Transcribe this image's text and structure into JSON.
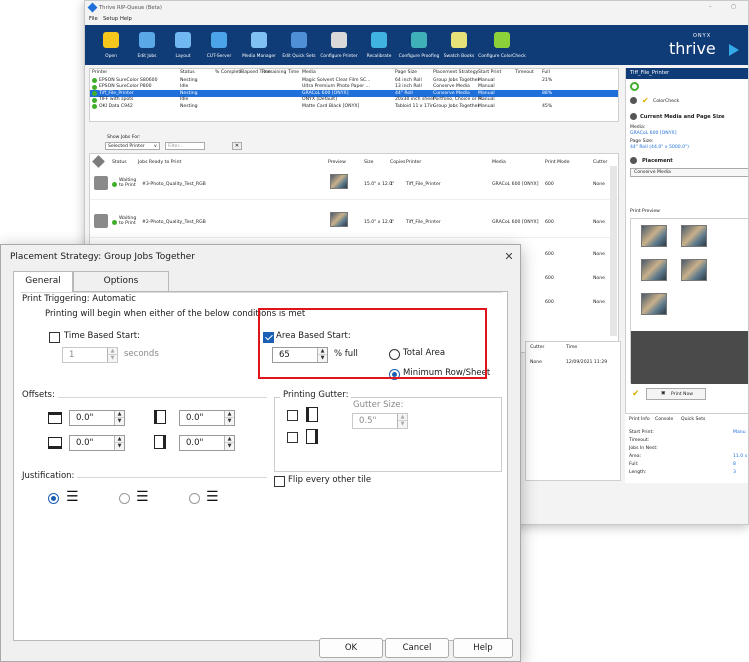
{
  "app": {
    "window_title": "Thrive RIP-Queue (Beta)",
    "menu": [
      "File",
      "Setup",
      "Help"
    ],
    "toolbar": [
      {
        "label": "Open",
        "icon": "folder-icon",
        "color": "#f5c61b"
      },
      {
        "label": "Edit Jobs",
        "icon": "gear-icon",
        "color": "#5aa9e6"
      },
      {
        "label": "Layout",
        "icon": "layout-icon",
        "color": "#6fb8f0"
      },
      {
        "label": "CUT-Server",
        "icon": "scissors-icon",
        "color": "#4da3e8"
      },
      {
        "label": "Media Manager",
        "icon": "media-icon",
        "color": "#7fc1f2"
      },
      {
        "label": "Edit Quick Sets",
        "icon": "quickset-icon",
        "color": "#4f8fd6"
      },
      {
        "label": "Configure Printer",
        "icon": "printer-icon",
        "color": "#d9d9d9"
      },
      {
        "label": "Recalibrate",
        "icon": "recalibrate-icon",
        "color": "#40b3e0"
      },
      {
        "label": "Configure Proofing",
        "icon": "proofing-icon",
        "color": "#3fb0b8"
      },
      {
        "label": "Swatch Books",
        "icon": "swatch-icon",
        "color": "#e6e27a"
      },
      {
        "label": "Configure ColorCheck",
        "icon": "colorcheck-icon",
        "color": "#8bd23a"
      }
    ],
    "brand_small": "ONYX",
    "brand_large": "thrive",
    "printer_columns": [
      "Printer",
      "Status",
      "% Complete",
      "Elapsed Time",
      "Remaining Time",
      "Media",
      "Page Size",
      "Placement Strategy",
      "Start Print",
      "Timeout",
      "Full"
    ],
    "printers": [
      {
        "name": "EPSON SureColor S80600",
        "status": "Nesting",
        "media": "Magic Solvent Clear Film SC...",
        "page": "64 inch Roll",
        "strategy": "Group Jobs Together",
        "start": "Manual",
        "full": "21%"
      },
      {
        "name": "EPSON SureColor P800",
        "status": "Idle",
        "media": "Ultra Premium Photo Paper ...",
        "page": "13 inch Roll",
        "strategy": "Conserve Media",
        "start": "Manual",
        "full": ""
      },
      {
        "name": "Tiff_File_Printer",
        "status": "Nesting",
        "media": "GRACoL 600 [ONYX]",
        "page": "44\" Roll",
        "strategy": "Conserve Media",
        "start": "Manual",
        "full": "88%"
      },
      {
        "name": "TIFF with spots",
        "status": "Idle",
        "media": "ONYX [Default]",
        "page": "20x30 inch sheet",
        "strategy": "Portfolio, Choice or Fi...",
        "start": "Manual",
        "full": ""
      },
      {
        "name": "OKI Data C942",
        "status": "Nesting",
        "media": "Matte Card Black [ONYX]",
        "page": "Tabloid 11 x 17in",
        "strategy": "Group Jobs Together",
        "start": "Manual",
        "full": "45%"
      }
    ],
    "show_jobs_label": "Show Jobs For:",
    "show_jobs_value": "Selected Printer",
    "filter_placeholder": "Filter...",
    "job_columns": [
      "Status",
      "Jobs Ready to Print",
      "Preview",
      "Size",
      "Copies",
      "Printer",
      "Media",
      "Print Mode",
      "Cutter"
    ],
    "jobs": [
      {
        "status": "Waiting to Print",
        "name": "#3-Photo_Quality_Test_RGB",
        "size": "15.0\" x 12.0\"",
        "copies": "1",
        "printer": "Tiff_File_Printer",
        "media": "GRACoL 600 [ONYX]",
        "mode": "600",
        "cutter": "None"
      },
      {
        "status": "Waiting to Print",
        "name": "#2-Photo_Quality_Test_RGB",
        "size": "15.0\" x 12.0\"",
        "copies": "1",
        "printer": "Tiff_File_Printer",
        "media": "GRACoL 600 [ONYX]",
        "mode": "600",
        "cutter": "None"
      }
    ],
    "hidden_job_rows": [
      {
        "mode": "600",
        "cutter": "None"
      },
      {
        "mode": "600",
        "cutter": "None"
      },
      {
        "mode": "600",
        "cutter": "None"
      }
    ],
    "lower_columns": [
      "Cutter",
      "Time"
    ],
    "lower_row": {
      "cutter": "None",
      "time": "12/09/2021 11:29"
    },
    "right_panel": {
      "title": "Tiff_File_Printer",
      "colorcheck": "ColorCheck",
      "section_media": "Current Media and Page Size",
      "media_label": "Media:",
      "media_value": "GRACoL 600 [ONYX]",
      "page_label": "Page Size:",
      "page_value": "44\" Roll (44.0\" x 5000.0\")",
      "section_placement": "Placement",
      "placement_value": "Conserve Media",
      "print_preview": "Print Preview",
      "print_now": "Print Now",
      "tabs": [
        "Print Info",
        "Console",
        "Quick Sets"
      ],
      "info": [
        {
          "k": "Start Print:",
          "v": "Manu"
        },
        {
          "k": "Timeout:",
          "v": ""
        },
        {
          "k": "Jobs In Nest:",
          "v": ""
        },
        {
          "k": "Area:",
          "v": "11.0 s"
        },
        {
          "k": "Full:",
          "v": "8"
        },
        {
          "k": "Length:",
          "v": "3"
        }
      ]
    }
  },
  "dialog": {
    "title": "Placement Strategy: Group Jobs Together",
    "tabs": [
      "General",
      "Options"
    ],
    "trigger_group": "Print Triggering: Automatic",
    "trigger_desc": "Printing will begin when either of the below conditions is met",
    "time_based": {
      "label": "Time Based Start:",
      "checked": false,
      "value": "1",
      "unit": "seconds"
    },
    "area_based": {
      "label": "Area Based Start:",
      "checked": true,
      "value": "65",
      "unit": "% full"
    },
    "area_options": [
      {
        "label": "Total Area",
        "selected": false
      },
      {
        "label": "Minimum Row/Sheet",
        "selected": true
      }
    ],
    "offsets": {
      "title": "Offsets:",
      "values": [
        "0.0\"",
        "0.0\"",
        "0.0\"",
        "0.0\""
      ]
    },
    "gutter": {
      "title": "Printing Gutter:",
      "size_label": "Gutter Size:",
      "size_value": "0.5\""
    },
    "justification": {
      "title": "Justification:",
      "selected_index": 0
    },
    "flip_label": "Flip every other tile",
    "buttons": {
      "ok": "OK",
      "cancel": "Cancel",
      "help": "Help"
    },
    "highlight_color": "#e0141b",
    "accent_color": "#1a5fb4"
  }
}
